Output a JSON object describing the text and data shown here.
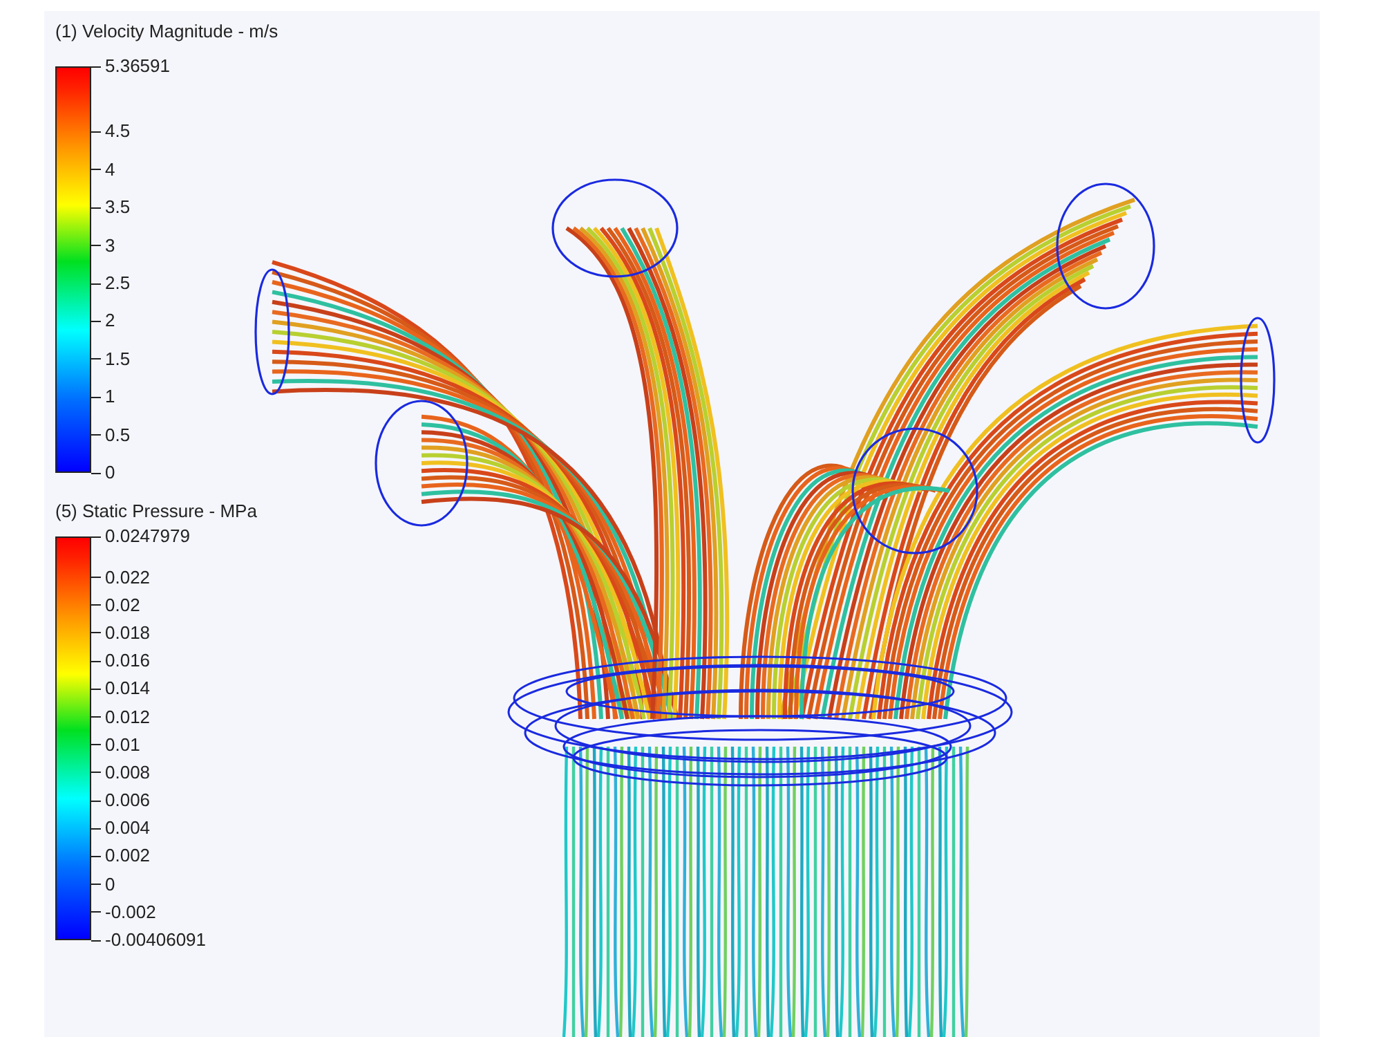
{
  "legends": [
    {
      "title": "(1) Velocity Magnitude - m/s",
      "ticks": [
        {
          "label": "5.36591",
          "kind": "max"
        },
        {
          "label": "4.5",
          "kind": "step"
        },
        {
          "label": "4",
          "kind": "step"
        },
        {
          "label": "3.5",
          "kind": "step"
        },
        {
          "label": "3",
          "kind": "step"
        },
        {
          "label": "2.5",
          "kind": "step"
        },
        {
          "label": "2",
          "kind": "step"
        },
        {
          "label": "1.5",
          "kind": "step"
        },
        {
          "label": "1",
          "kind": "step"
        },
        {
          "label": "0.5",
          "kind": "step"
        },
        {
          "label": "0",
          "kind": "min"
        }
      ]
    },
    {
      "title": "(5) Static Pressure - MPa",
      "ticks": [
        {
          "label": "0.0247979",
          "kind": "max"
        },
        {
          "label": "0.022",
          "kind": "step"
        },
        {
          "label": "0.02",
          "kind": "step"
        },
        {
          "label": "0.018",
          "kind": "step"
        },
        {
          "label": "0.016",
          "kind": "step"
        },
        {
          "label": "0.014",
          "kind": "step"
        },
        {
          "label": "0.012",
          "kind": "step"
        },
        {
          "label": "0.01",
          "kind": "step"
        },
        {
          "label": "0.008",
          "kind": "step"
        },
        {
          "label": "0.006",
          "kind": "step"
        },
        {
          "label": "0.004",
          "kind": "step"
        },
        {
          "label": "0.002",
          "kind": "step"
        },
        {
          "label": "0",
          "kind": "step"
        },
        {
          "label": "-0.002",
          "kind": "step"
        },
        {
          "label": "-0.00406091",
          "kind": "min"
        }
      ]
    }
  ]
}
